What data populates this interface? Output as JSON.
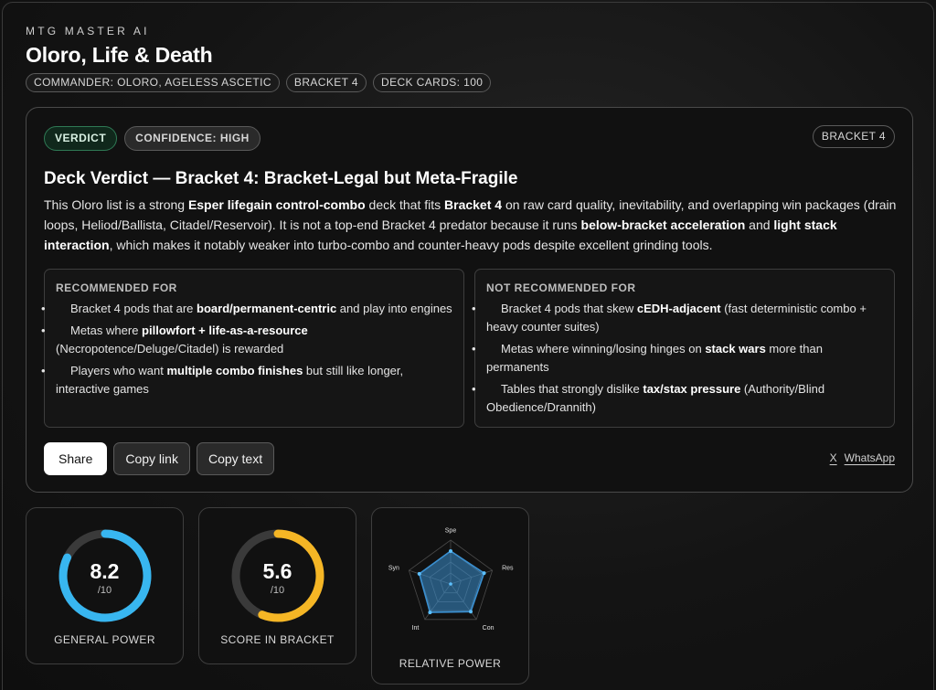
{
  "header": {
    "brand": "MTG MASTER AI",
    "title": "Oloro, Life & Death",
    "chips": [
      "COMMANDER: OLORO, AGELESS ASCETIC",
      "BRACKET 4",
      "DECK CARDS: 100"
    ]
  },
  "verdict": {
    "badge_verdict": "VERDICT",
    "badge_confidence": "CONFIDENCE: HIGH",
    "badge_bracket": "BRACKET 4",
    "heading": "Deck Verdict — Bracket 4: Bracket-Legal but Meta-Fragile",
    "body": [
      {
        "t": "This Oloro list is a strong "
      },
      {
        "t": "Esper lifegain control-combo",
        "b": true
      },
      {
        "t": " deck that fits "
      },
      {
        "t": "Bracket 4",
        "b": true
      },
      {
        "t": " on raw card quality, inevitability, and overlapping win packages (drain loops, Heliod/Ballista, Citadel/Reservoir). It is not a top-end Bracket 4 predator because it runs "
      },
      {
        "t": "below-bracket acceleration",
        "b": true
      },
      {
        "t": " and "
      },
      {
        "t": "light stack interaction",
        "b": true
      },
      {
        "t": ", which makes it notably weaker into turbo-combo and counter-heavy pods despite excellent grinding tools."
      }
    ],
    "recommended": {
      "title": "RECOMMENDED FOR",
      "items": [
        [
          {
            "t": "Bracket 4 pods that are "
          },
          {
            "t": "board/permanent-centric",
            "b": true
          },
          {
            "t": " and play into engines"
          }
        ],
        [
          {
            "t": "Metas where "
          },
          {
            "t": "pillowfort + life-as-a-resource",
            "b": true
          },
          {
            "t": " (Necropotence/Deluge/Citadel) is rewarded"
          }
        ],
        [
          {
            "t": "Players who want "
          },
          {
            "t": "multiple combo finishes",
            "b": true
          },
          {
            "t": " but still like longer, interactive games"
          }
        ]
      ]
    },
    "not_recommended": {
      "title": "NOT RECOMMENDED FOR",
      "items": [
        [
          {
            "t": "Bracket 4 pods that skew "
          },
          {
            "t": "cEDH-adjacent",
            "b": true
          },
          {
            "t": " (fast deterministic combo + heavy counter suites)"
          }
        ],
        [
          {
            "t": "Metas where winning/losing hinges on "
          },
          {
            "t": "stack wars",
            "b": true
          },
          {
            "t": " more than permanents"
          }
        ],
        [
          {
            "t": "Tables that strongly dislike "
          },
          {
            "t": "tax/stax pressure",
            "b": true
          },
          {
            "t": " (Authority/Blind Obedience/Drannith)"
          }
        ]
      ]
    },
    "actions": {
      "share": "Share",
      "copy_link": "Copy link",
      "copy_text": "Copy text"
    },
    "social": {
      "x": "X",
      "whatsapp": "WhatsApp"
    }
  },
  "metrics": {
    "general_power": {
      "value": "8.2",
      "unit": "/10",
      "label": "GENERAL POWER",
      "fraction": 0.82,
      "color": "#38b6f0"
    },
    "score_in_bracket": {
      "value": "5.6",
      "unit": "/10",
      "label": "SCORE IN BRACKET",
      "fraction": 0.56,
      "color": "#f5b625"
    },
    "relative_power": {
      "label": "RELATIVE POWER",
      "axes": [
        "Spe",
        "Res",
        "Con",
        "Int",
        "Syn"
      ],
      "values": [
        0.75,
        0.8,
        0.78,
        0.8,
        0.75
      ],
      "color": "#3a8fd0"
    }
  }
}
